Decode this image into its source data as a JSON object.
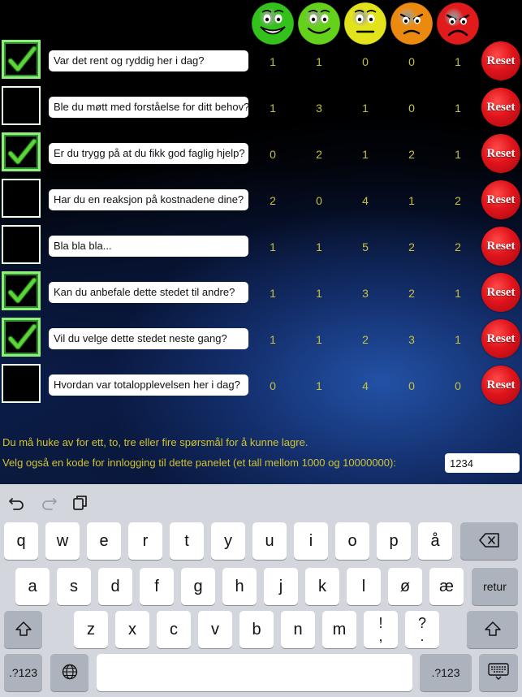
{
  "colors": {
    "count_text": "#c8c23a",
    "note_text": "#d2c430",
    "reset_red": "#e0141b",
    "check_green": "#5fd33a",
    "smiley_colors": [
      "#33c21b",
      "#64d11a",
      "#e3e31b",
      "#ec8a10",
      "#e11b1b"
    ]
  },
  "smileys": [
    {
      "icon": "very-happy-face-icon"
    },
    {
      "icon": "happy-face-icon"
    },
    {
      "icon": "neutral-face-icon"
    },
    {
      "icon": "annoyed-face-icon"
    },
    {
      "icon": "angry-face-icon"
    }
  ],
  "questions": [
    {
      "checked": true,
      "text": "Var det rent og ryddig her i dag?",
      "counts": [
        "1",
        "1",
        "0",
        "0",
        "1"
      ],
      "reset": "Reset"
    },
    {
      "checked": false,
      "text": "Ble du møtt med forståelse for ditt behov?",
      "counts": [
        "1",
        "3",
        "1",
        "0",
        "1"
      ],
      "reset": "Reset"
    },
    {
      "checked": true,
      "text": "Er du trygg på at du fikk god faglig hjelp?",
      "counts": [
        "0",
        "2",
        "1",
        "2",
        "1"
      ],
      "reset": "Reset"
    },
    {
      "checked": false,
      "text": "Har du en reaksjon på kostnadene dine?",
      "counts": [
        "2",
        "0",
        "4",
        "1",
        "2"
      ],
      "reset": "Reset"
    },
    {
      "checked": false,
      "text": "Bla bla bla...",
      "counts": [
        "1",
        "1",
        "5",
        "2",
        "2"
      ],
      "reset": "Reset"
    },
    {
      "checked": true,
      "text": "Kan du anbefale dette stedet til andre?",
      "counts": [
        "1",
        "1",
        "3",
        "2",
        "1"
      ],
      "reset": "Reset"
    },
    {
      "checked": true,
      "text": "Vil du velge dette stedet neste gang?",
      "counts": [
        "1",
        "1",
        "2",
        "3",
        "1"
      ],
      "reset": "Reset"
    },
    {
      "checked": false,
      "text": "Hvordan var totalopplevelsen her i dag?",
      "counts": [
        "0",
        "1",
        "4",
        "0",
        "0"
      ],
      "reset": "Reset"
    }
  ],
  "notes": {
    "instruction": "Du må huke av for ett, to, tre eller fire spørsmål for å kunne lagre.",
    "code_label": "Velg også en kode for innlogging til dette panelet (et tall mellom 1000 og 10000000):",
    "code_value": "1234"
  },
  "keyboard": {
    "toolbar": [
      {
        "icon": "undo-icon"
      },
      {
        "icon": "redo-icon"
      },
      {
        "icon": "paste-icon"
      }
    ],
    "row1": [
      "q",
      "w",
      "e",
      "r",
      "t",
      "y",
      "u",
      "i",
      "o",
      "p",
      "å"
    ],
    "row2": [
      "a",
      "s",
      "d",
      "f",
      "g",
      "h",
      "j",
      "k",
      "l",
      "ø",
      "æ"
    ],
    "row3": [
      "z",
      "x",
      "c",
      "v",
      "b",
      "n",
      "m"
    ],
    "punct1": {
      "top": "!",
      "bottom": ","
    },
    "punct2": {
      "top": "?",
      "bottom": "."
    },
    "return_label": "retur",
    "numbers_label": ".?123",
    "backspace_icon": "backspace-icon",
    "shift_icon": "shift-icon",
    "globe_icon": "globe-icon",
    "hide_keyboard_icon": "keyboard-dismiss-icon"
  }
}
